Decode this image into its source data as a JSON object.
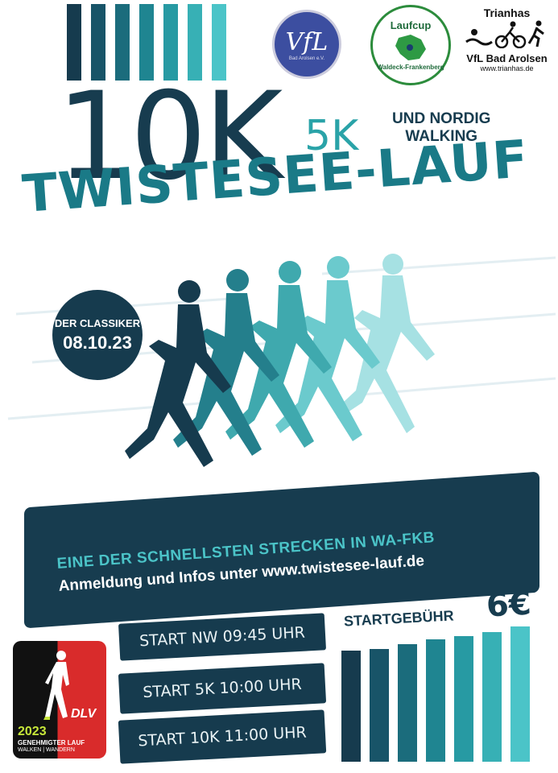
{
  "logos": {
    "vfl": {
      "text": "VfL",
      "sub": "Bad Arolsen e.V."
    },
    "laufcup": {
      "top": "Laufcup",
      "bottom": "Waldeck-Frankenberg"
    },
    "trianhas": {
      "title": "Trianhas",
      "club": "VfL Bad Arolsen",
      "url": "www.trianhas.de"
    }
  },
  "distances": {
    "main": "10K",
    "secondary": "5K",
    "nordic_line1": "UND NORDIG",
    "nordic_line2": "WALKING"
  },
  "event_title": "TWISTESEE-LAUF",
  "badge": {
    "line1": "DER CLASSIKER",
    "date": "08.10.23"
  },
  "banner": {
    "line1": "EINE DER SCHNELLSTEN STRECKEN IN WA-FKB",
    "line2": "Anmeldung und Infos unter www.twistesee-lauf.de"
  },
  "fee": {
    "label": "STARTGEBÜHR",
    "value": "6€"
  },
  "starts": [
    "START NW 09:45 UHR",
    "START 5K 10:00 UHR",
    "START 10K 11:00 UHR"
  ],
  "dlv": {
    "brand": "DLV",
    "year": "2023",
    "line1": "GENEHMIGTER LAUF",
    "line2": "WALKEN | WANDERN"
  },
  "colors": {
    "navy": "#173c4f",
    "teal": "#1a7a87",
    "aqua": "#4bc4c8",
    "red": "#d92b2b"
  }
}
